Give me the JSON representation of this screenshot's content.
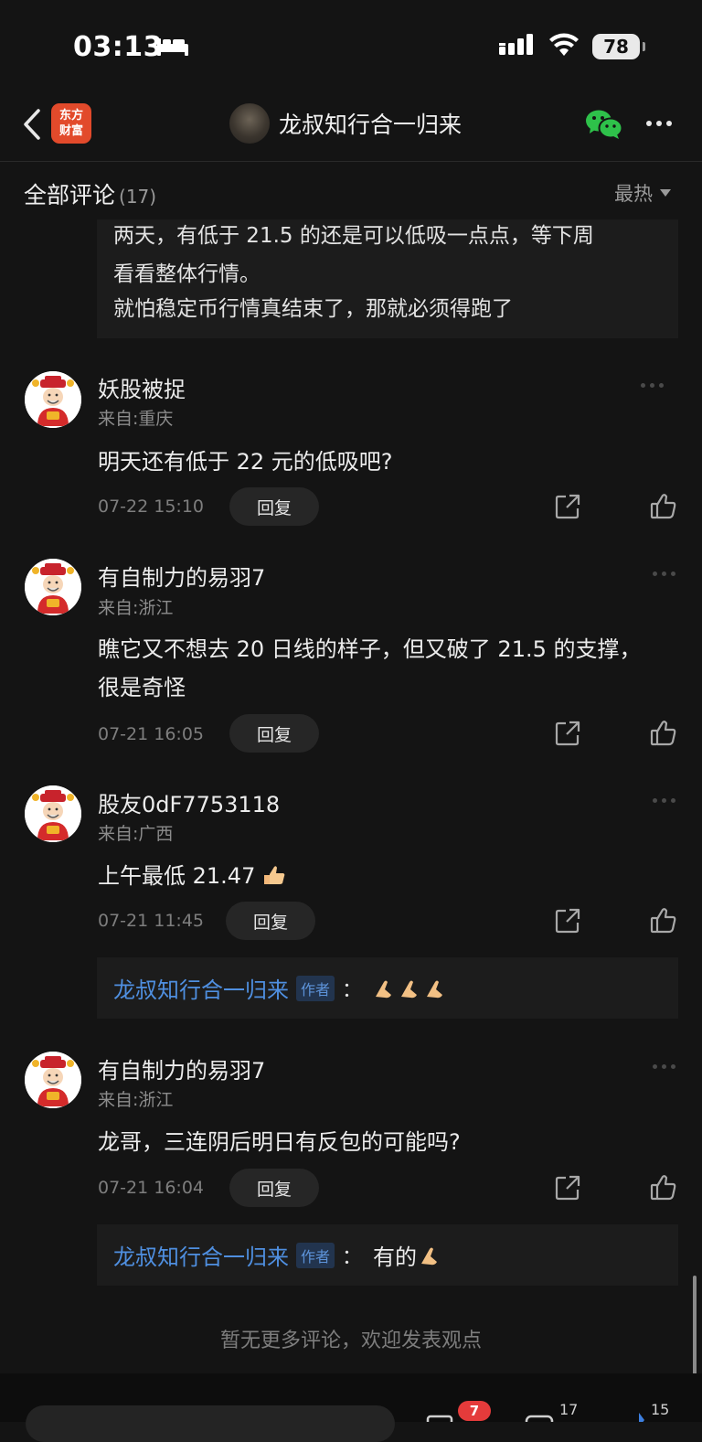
{
  "status_bar": {
    "time": "03:13",
    "battery": "78"
  },
  "nav": {
    "logo_line1": "东方",
    "logo_line2": "财富",
    "title": "龙叔知行合一归来"
  },
  "comments_header": {
    "title": "全部评论",
    "count": "(17)",
    "sort": "最热"
  },
  "quote": {
    "lines": [
      "两天，有低于 21.5 的还是可以低吸一点点，等下周",
      "看看整体行情。",
      "就怕稳定币行情真结束了，那就必须得跑了"
    ]
  },
  "comments": [
    {
      "username": "妖股被捉",
      "location": "来自:重庆",
      "text_lines": [
        "明天还有低于 22 元的低吸吧?"
      ],
      "time": "07-22 15:10",
      "reply_label": "回复"
    },
    {
      "username": "有自制力的易羽7",
      "location": "来自:浙江",
      "text_lines": [
        "瞧它又不想去 20 日线的样子，但又破了 21.5 的支撑，",
        "很是奇怪"
      ],
      "time": "07-21 16:05",
      "reply_label": "回复"
    },
    {
      "username": "股友0dF7753118",
      "location": "来自:广西",
      "text_lines": [
        "上午最低 21.47"
      ],
      "time": "07-21 11:45",
      "reply_label": "回复",
      "author_reply": {
        "author": "龙叔知行合一归来",
        "tag": "作者",
        "colon": "：",
        "text": ""
      }
    },
    {
      "username": "有自制力的易羽7",
      "location": "来自:浙江",
      "text_lines": [
        "龙哥，三连阴后明日有反包的可能吗?"
      ],
      "time": "07-21 16:04",
      "reply_label": "回复",
      "author_reply": {
        "author": "龙叔知行合一归来",
        "tag": "作者",
        "colon": "：",
        "text": "有的"
      }
    }
  ],
  "footer": {
    "end_text": "暂无更多评论，欢迎发表观点"
  },
  "bottom_bar": {
    "badge": "7",
    "comments_count": "17",
    "likes_count": "15"
  },
  "colors": {
    "background": "#141414",
    "author_blue": "#4f8fe0",
    "badge_red": "#e43b3b",
    "logo_red": "#e24a2b"
  }
}
